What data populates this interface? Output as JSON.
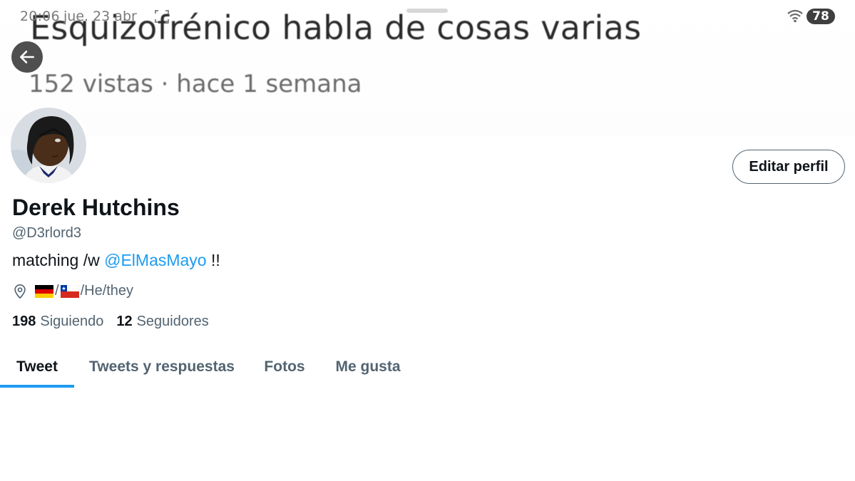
{
  "status_bar": {
    "time": "20:06",
    "date": "jue. 23 abr",
    "battery": "78"
  },
  "banner": {
    "title": "Esquizofrénico habla de cosas varias",
    "subtitle": "152 vistas · hace 1 semana"
  },
  "profile": {
    "name": "Derek Hutchins",
    "handle": "@D3rlord3",
    "bio_prefix": "matching /w ",
    "bio_mention": "@ElMasMayo",
    "bio_suffix": " !!",
    "location_sep1": "/",
    "location_sep2": "/",
    "location_text": "He/they",
    "edit_button": "Editar perfil",
    "following_count": "198",
    "following_label": "Siguiendo",
    "followers_count": "12",
    "followers_label": "Seguidores"
  },
  "tabs": [
    {
      "label": "Tweet",
      "active": true
    },
    {
      "label": "Tweets y respuestas",
      "active": false
    },
    {
      "label": "Fotos",
      "active": false
    },
    {
      "label": "Me gusta",
      "active": false
    }
  ],
  "colors": {
    "accent": "#1d9bf0",
    "text_primary": "#0f1419",
    "text_secondary": "#536471"
  },
  "icons": {
    "back": "arrow-left-icon",
    "location": "location-pin-icon",
    "wifi": "wifi-icon",
    "screenshot": "screenshot-icon"
  }
}
